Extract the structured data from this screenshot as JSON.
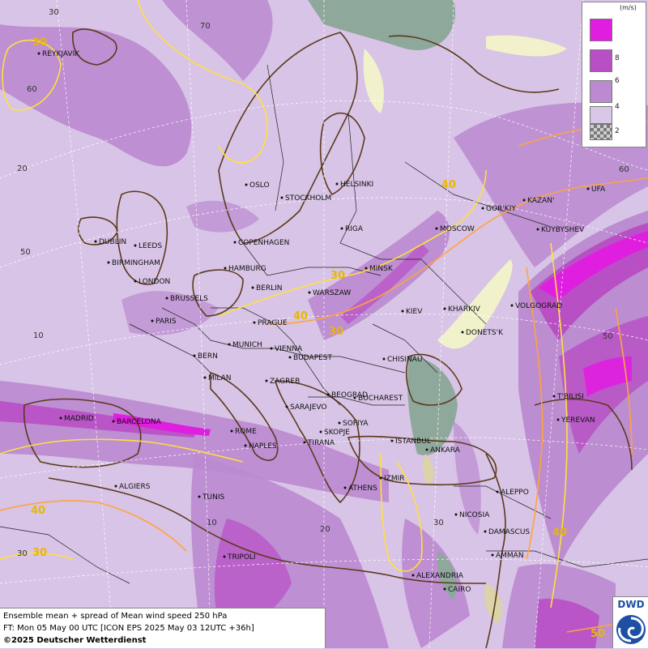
{
  "legend": {
    "unit": "(m/s)",
    "levels": [
      "8",
      "6",
      "4",
      "2"
    ],
    "colors": [
      "#e01ee0",
      "#b84fc4",
      "#bb8ad0",
      "#d9c7e8",
      "#9a9a9a"
    ]
  },
  "info": {
    "line1": "Ensemble mean + spread of Mean wind speed 250 hPa",
    "line2": "FT: Mon 05 May 00 UTC [ICON EPS 2025 May 03 12UTC +36h]",
    "copyright": "©2025 Deutscher Wetterdienst"
  },
  "logo": {
    "text": "DWD",
    "icon": "dwd-swirl-icon"
  },
  "contour_labels": [
    "30",
    "40",
    "30",
    "40",
    "30",
    "40",
    "30",
    "40",
    "50"
  ],
  "grid_labels": [
    "30",
    "70",
    "60",
    "20",
    "50",
    "10",
    "10",
    "20",
    "30",
    "30",
    "50",
    "60"
  ],
  "cities": [
    "REYKJAVIK",
    "OSLO",
    "STOCKHOLM",
    "HELSINKI",
    "DUBLIN",
    "LEEDS",
    "BIRMINGHAM",
    "LONDON",
    "COPENHAGEN",
    "HAMBURG",
    "BERLIN",
    "RIGA",
    "MOSCOW",
    "GOR'KIY",
    "KAZAN'",
    "UFA",
    "KUYBYSHEV",
    "MINSK",
    "WARSZAW",
    "BRUSSELS",
    "PARIS",
    "PRAGUE",
    "KIEV",
    "KHARKIV",
    "VOLGOGRAD",
    "DONETS'K",
    "MUNICH",
    "VIENNA",
    "BERN",
    "BUDAPEST",
    "CHISINAU",
    "MILAN",
    "ZAGREB",
    "BEOGRAD",
    "BUCHAREST",
    "T'BILISI",
    "YEREVAN",
    "MADRID",
    "BARCELONA",
    "SARAJEVO",
    "SOFIYA",
    "ROME",
    "NAPLES",
    "SKOPJE",
    "TIRANA",
    "ISTANBUL",
    "ANKARA",
    "ALGIERS",
    "ATHENS",
    "IZMIR",
    "ALEPPO",
    "TUNIS",
    "NICOSIA",
    "DAMASCUS",
    "AMMAN",
    "TRIPOLI",
    "ALEXANDRIA",
    "CAIRO"
  ]
}
